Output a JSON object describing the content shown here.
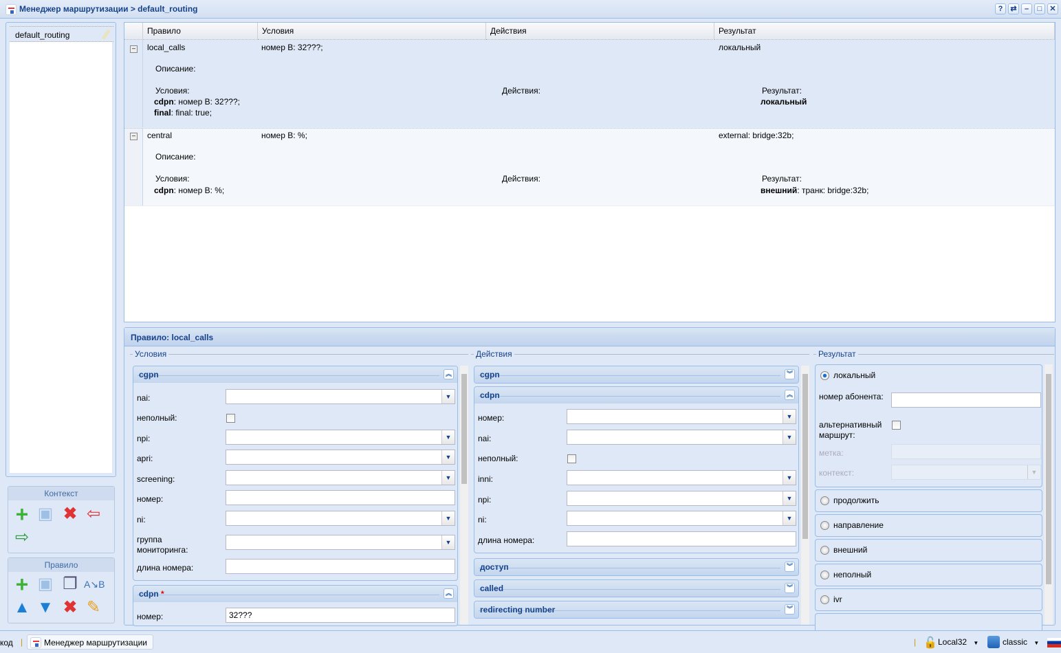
{
  "window": {
    "title": "Менеджер маршрутизации > default_routing",
    "tools": [
      "?",
      "⇄",
      "–",
      "□",
      "✕"
    ]
  },
  "contexts": {
    "items": [
      "default_routing"
    ]
  },
  "context_toolbar": {
    "title": "Контекст"
  },
  "rule_toolbar": {
    "title": "Правило"
  },
  "grid": {
    "columns": [
      "Правило",
      "Условия",
      "Действия",
      "Результат"
    ],
    "rows": [
      {
        "rule": "local_calls",
        "conditions": "номер B: 32???;",
        "actions": "",
        "result": "локальный",
        "desc_label": "Описание:",
        "cond_label": "Условия:",
        "act_label": "Действия:",
        "res_label": "Результат:",
        "details": [
          {
            "key": "cdpn",
            "val": ": номер B: 32???;"
          },
          {
            "key": "final",
            "val": ": final: true;"
          }
        ],
        "res_detail_key": "локальный",
        "res_detail_val": ""
      },
      {
        "rule": "central",
        "conditions": "номер B: %;",
        "actions": "",
        "result": "external: bridge:32b;",
        "desc_label": "Описание:",
        "cond_label": "Условия:",
        "act_label": "Действия:",
        "res_label": "Результат:",
        "details": [
          {
            "key": "cdpn",
            "val": ": номер B: %;"
          }
        ],
        "res_detail_key": "внешний",
        "res_detail_val": ": транк: bridge:32b;"
      }
    ]
  },
  "rule_form": {
    "title": "Правило: local_calls",
    "conditions": {
      "legend": "Условия",
      "cgpn": {
        "title": "cgpn",
        "nai": "nai:",
        "incomplete": "неполный:",
        "npi": "npi:",
        "apri": "apri:",
        "screening": "screening:",
        "number": "номер:",
        "ni": "ni:",
        "group": "группа мониторинга:",
        "length": "длина номера:"
      },
      "cdpn": {
        "title": "cdpn",
        "required": "*",
        "number": "номер:",
        "number_value": "32???"
      }
    },
    "actions": {
      "legend": "Действия",
      "cgpn": {
        "title": "cgpn"
      },
      "cdpn": {
        "title": "cdpn",
        "number": "номер:",
        "nai": "nai:",
        "incomplete": "неполный:",
        "inni": "inni:",
        "npi": "npi:",
        "ni": "ni:",
        "length": "длина номера:"
      },
      "collapsed": [
        "доступ",
        "called",
        "redirecting number"
      ]
    },
    "result": {
      "legend": "Результат",
      "selected": "локальный",
      "local": {
        "label": "локальный",
        "subscriber": "номер абонента:",
        "alt_route": "альтернативный маршрут:",
        "tag": "метка:",
        "context": "контекст:"
      },
      "options": [
        "продолжить",
        "направление",
        "внешний",
        "неполный",
        "ivr"
      ]
    }
  },
  "status": {
    "left_text": "код",
    "task": "Менеджер маршрутизации",
    "user": "Local32",
    "theme": "classic"
  },
  "colors": {
    "accent": "#15428b",
    "panel": "#dfe8f6",
    "border": "#99bbe8"
  }
}
